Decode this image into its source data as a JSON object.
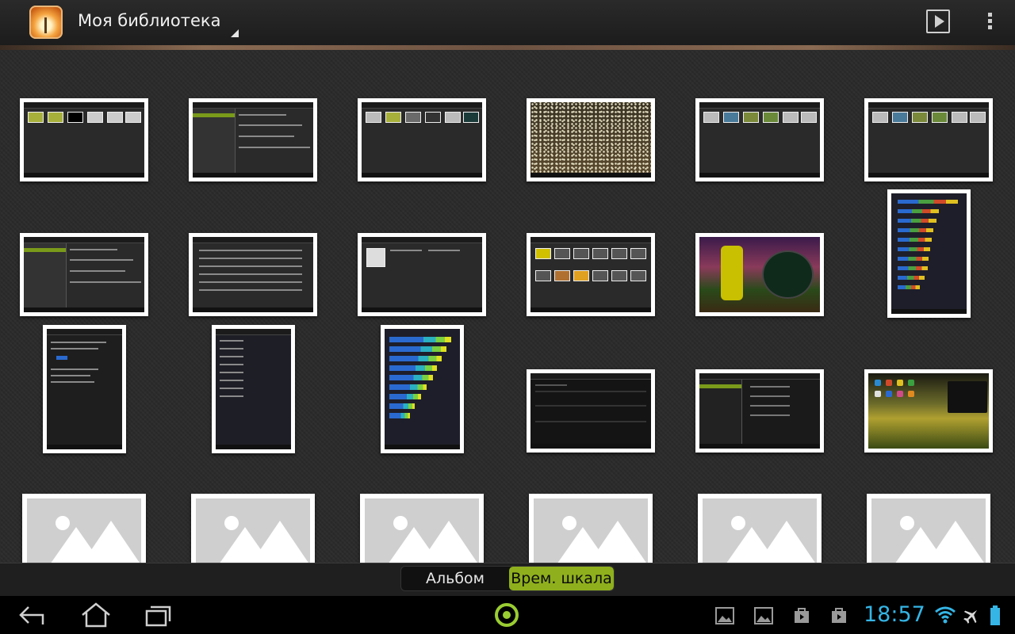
{
  "action_bar": {
    "title": "Моя библиотека"
  },
  "view_toggle": {
    "album_label": "Альбом",
    "timeline_label": "Врем. шкала",
    "selected": "timeline"
  },
  "status_bar": {
    "time": "18:57"
  },
  "colors": {
    "accent_green": "#8fb01c",
    "clock_blue": "#35b5e5"
  },
  "icons": {
    "back": "back-icon",
    "home": "home-icon",
    "recents": "recent-apps-icon",
    "center": "launcher-ring-icon",
    "notif": [
      "gallery-icon",
      "gallery-icon",
      "store-icon",
      "store-icon"
    ],
    "status": [
      "wifi-icon",
      "airplane-icon",
      "battery-icon"
    ]
  }
}
